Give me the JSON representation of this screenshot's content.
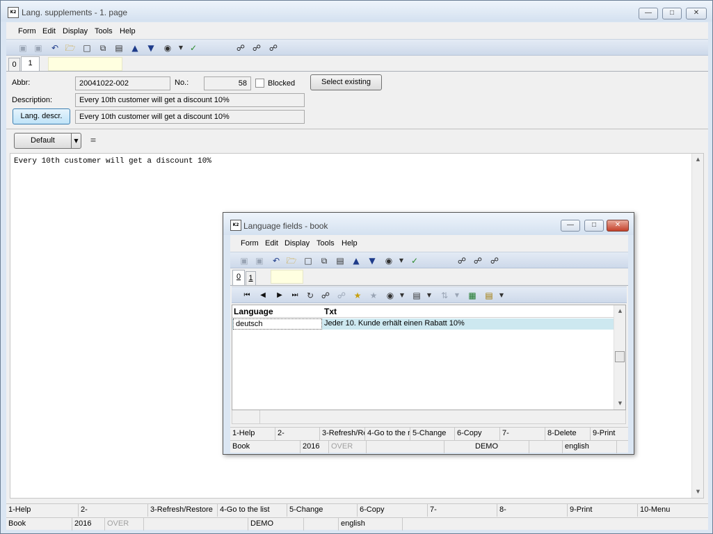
{
  "main": {
    "title": "Lang. supplements - 1. page",
    "icon_label": "K2",
    "menu": [
      "Form",
      "Edit",
      "Display",
      "Tools",
      "Help"
    ],
    "tabs": [
      "0",
      "1"
    ],
    "abbr_label": "Abbr:",
    "abbr_value": "20041022-002",
    "no_label": "No.:",
    "no_value": "58",
    "blocked_label": "Blocked",
    "select_existing": "Select existing",
    "description_label": "Description:",
    "description_value": "Every 10th customer will get a discount 10%",
    "lang_descr_button": "Lang. descr.",
    "lang_descr_value": "Every 10th customer will get a discount 10%",
    "default_button": "Default",
    "text_content": "Every 10th customer will get a discount 10%",
    "fkeys": [
      "1-Help",
      "2-",
      "3-Refresh/Restore",
      "4-Go to the list",
      "5-Change",
      "6-Copy",
      "7-",
      "8-",
      "9-Print",
      "10-Menu"
    ],
    "status": [
      "Book",
      "2016",
      "OVER",
      "",
      "DEMO",
      "",
      "english",
      ""
    ]
  },
  "dialog": {
    "title": "Language fields - book",
    "icon_label": "K2",
    "menu": [
      "Form",
      "Edit",
      "Display",
      "Tools",
      "Help"
    ],
    "tabs": [
      "0",
      "1"
    ],
    "columns": [
      "Language",
      "Txt"
    ],
    "rows": [
      {
        "language": "deutsch",
        "txt": "Jeder 10. Kunde erhält einen Rabatt 10%"
      }
    ],
    "fkeys": [
      "1-Help",
      "2-",
      "3-Refresh/Re",
      "4-Go to the r",
      "5-Change",
      "6-Copy",
      "7-",
      "8-Delete",
      "9-Print"
    ],
    "status": [
      "Book",
      "2016",
      "OVER",
      "",
      "DEMO",
      "",
      "english",
      ""
    ]
  },
  "icons": {
    "toolbar": [
      "save-icon",
      "save-as-icon",
      "undo-icon",
      "open-icon",
      "new-icon",
      "copy-icon",
      "book-icon",
      "up-icon",
      "down-icon",
      "camera-icon",
      "filter-icon",
      "find-icon",
      "find-next-icon",
      "find-prev-icon"
    ]
  }
}
